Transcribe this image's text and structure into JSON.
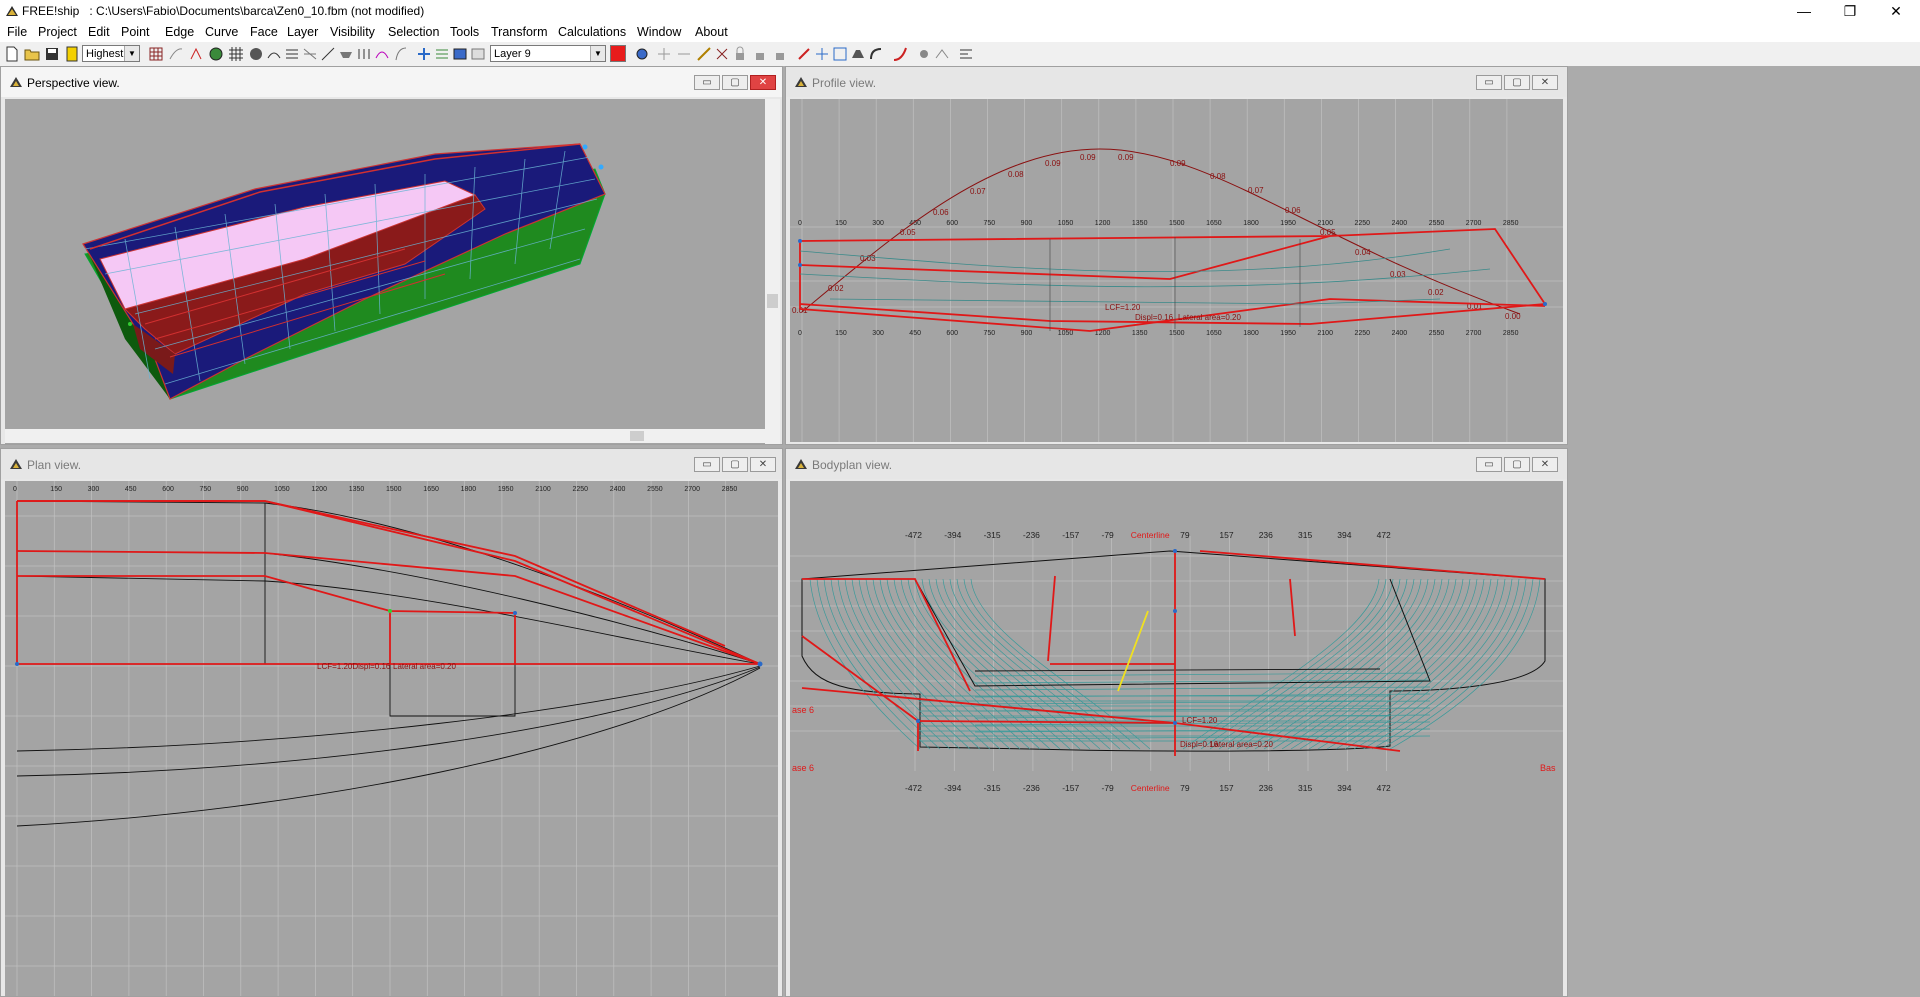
{
  "titlebar": {
    "app": "FREE!ship",
    "path": ": C:\\Users\\Fabio\\Documents\\barca\\Zen0_10.fbm (not modified)"
  },
  "menu": [
    "File",
    "Project",
    "Edit",
    "Point",
    "Edge",
    "Curve",
    "Face",
    "Layer",
    "Visibility",
    "Selection",
    "Tools",
    "Transform",
    "Calculations",
    "Window",
    "About"
  ],
  "toolbar": {
    "precision": "Highest",
    "layer": "Layer 9",
    "layer_color": "#e81c1c"
  },
  "views": {
    "perspective": {
      "title": "Perspective view."
    },
    "profile": {
      "title": "Profile view.",
      "x_ticks": [
        "0",
        "150",
        "300",
        "450",
        "600",
        "750",
        "900",
        "1050",
        "1200",
        "1350",
        "1500",
        "1650",
        "1800",
        "1950",
        "2100",
        "2250",
        "2400",
        "2550",
        "2700",
        "2850"
      ],
      "area_labels": [
        "0.01",
        "0.02",
        "0.03",
        "0.05",
        "0.06",
        "0.07",
        "0.08",
        "0.09",
        "0.09",
        "0.09",
        "0.09",
        "0.08",
        "0.07",
        "0.06",
        "0.05",
        "0.04",
        "0.03",
        "0.02",
        "0.01",
        "0.00"
      ],
      "lcf": "LCF=1.20",
      "displ": "Displ=0.16",
      "lateral": "Lateral area=0.20"
    },
    "plan": {
      "title": "Plan view.",
      "x_ticks": [
        "0",
        "150",
        "300",
        "450",
        "600",
        "750",
        "900",
        "1050",
        "1200",
        "1350",
        "1500",
        "1650",
        "1800",
        "1950",
        "2100",
        "2250",
        "2400",
        "2550",
        "2700",
        "2850"
      ],
      "lcf_displ": "LCF=1.20Displ=0.16",
      "lateral": "Lateral area=0.20"
    },
    "bodyplan": {
      "title": "Bodyplan view.",
      "ticks": [
        "-472",
        "-394",
        "-315",
        "-236",
        "-157",
        "-79",
        "Centerline",
        "79",
        "157",
        "236",
        "315",
        "394",
        "472"
      ],
      "lcf": "LCF=1.20",
      "displ": "Displ=0.16",
      "lateral": "Lateral area=0.20",
      "base_left": "ase 6",
      "base_right": "Bas"
    }
  }
}
